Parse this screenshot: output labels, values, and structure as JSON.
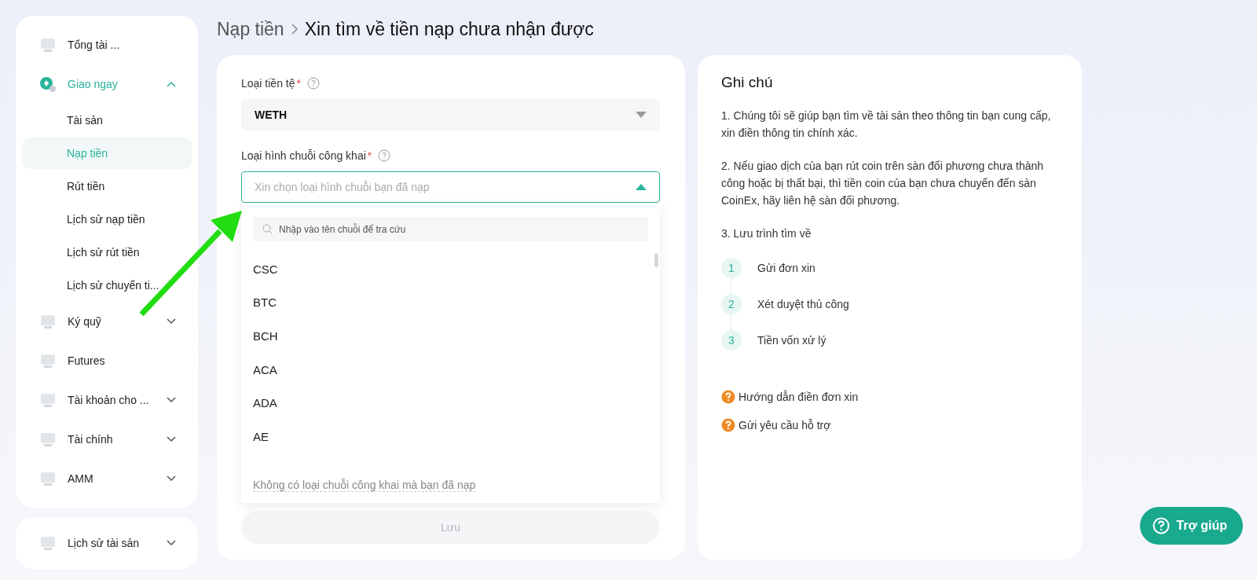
{
  "sidebar": {
    "items": [
      {
        "kind": "link",
        "label": "Tổng tài ..."
      },
      {
        "kind": "group",
        "label": "Giao ngay",
        "expanded": true,
        "children": [
          {
            "label": "Tài sản",
            "selected": false
          },
          {
            "label": "Nạp tiền",
            "selected": true
          },
          {
            "label": "Rút tiền",
            "selected": false
          },
          {
            "label": "Lịch sử nạp tiền",
            "selected": false
          },
          {
            "label": "Lịch sử rút tiền",
            "selected": false
          },
          {
            "label": "Lịch sử chuyển ti...",
            "selected": false
          }
        ]
      },
      {
        "kind": "group",
        "label": "Ký quỹ",
        "expanded": false
      },
      {
        "kind": "link",
        "label": "Futures"
      },
      {
        "kind": "group",
        "label": "Tài khoản cho ...",
        "expanded": false
      },
      {
        "kind": "group",
        "label": "Tài chính",
        "expanded": false
      },
      {
        "kind": "group",
        "label": "AMM",
        "expanded": false
      }
    ],
    "bottom_items": [
      {
        "kind": "group",
        "label": "Lịch sử tài sản",
        "expanded": false
      }
    ]
  },
  "breadcrumb": [
    "Nạp tiền",
    "Xin tìm về tiền nạp chưa nhận được"
  ],
  "form": {
    "currency": {
      "label": "Loại tiền tệ",
      "required_mark": "*",
      "value": "WETH"
    },
    "chain": {
      "label": "Loại hình chuỗi công khai",
      "required_mark": "*",
      "placeholder": "Xin chọn loại hình chuỗi bạn đã nạp",
      "expanded": true
    },
    "dropdown": {
      "search_placeholder": "Nhập vào tên chuỗi để tra cứu",
      "options": [
        "CSC",
        "BTC",
        "BCH",
        "ACA",
        "ADA",
        "AE"
      ],
      "footer_link": "Không có loại chuỗi công khai mà bạn đã nạp"
    },
    "save_button": {
      "label": "Lưu",
      "disabled": true
    }
  },
  "notes": {
    "title": "Ghi chú",
    "paragraphs": [
      "1. Chúng tôi sẽ giúp bạn tìm về tài sản theo thông tin bạn cung cấp, xin điền thông tin chính xác.",
      "2. Nếu giao dịch của bạn rút coin trên sàn đối phương chưa thành công hoặc bị thất bại, thì tiền coin của bạn chưa chuyển đến sàn CoinEx, hãy liên hệ sàn đối phương.",
      "3. Lưu trình tìm về"
    ],
    "steps": [
      {
        "number": "1",
        "label": "Gửi đơn xin"
      },
      {
        "number": "2",
        "label": "Xét duyệt thủ công"
      },
      {
        "number": "3",
        "label": "Tiền vốn xử lý"
      }
    ],
    "links": [
      "Hướng dẫn điền đơn xin",
      "Gửi yêu cầu hỗ trợ"
    ]
  },
  "help_button": {
    "label": "Trợ giúp"
  }
}
